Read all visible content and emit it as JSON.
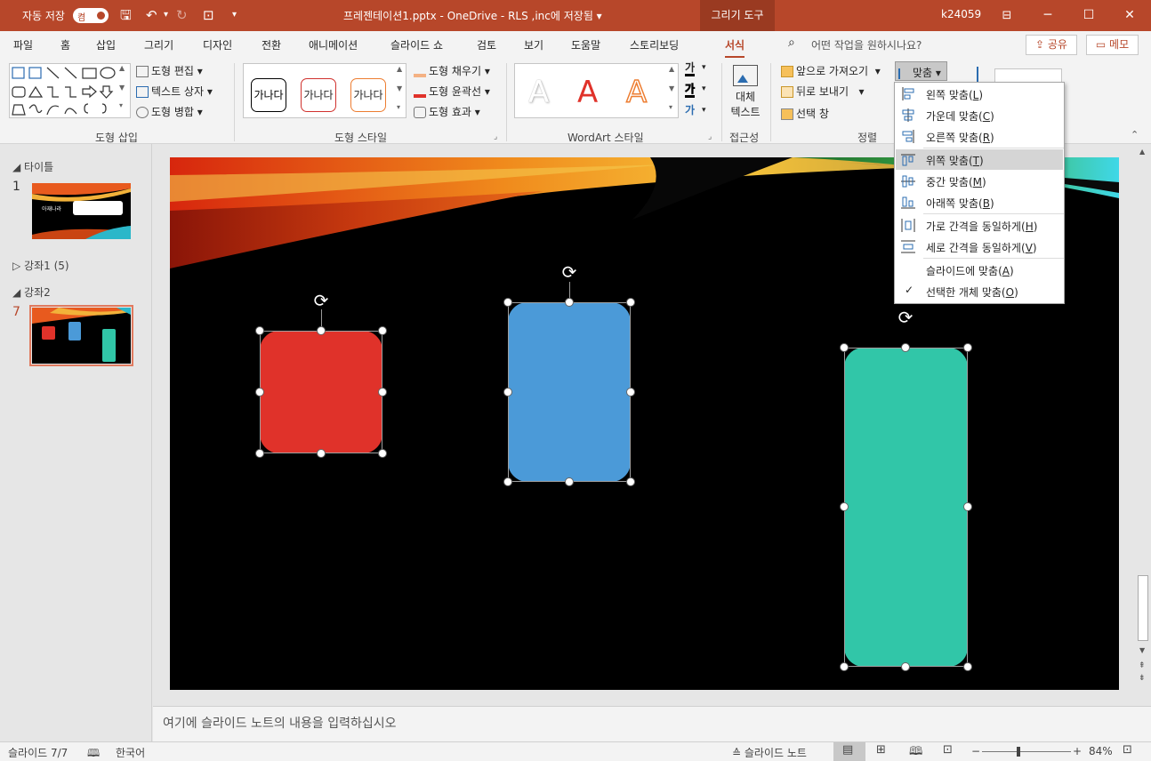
{
  "titlebar": {
    "autosave_label": "자동 저장",
    "autosave_state": "켬",
    "document_title": "프레젠테이션1.pptx - OneDrive - RLS ,inc에 저장됨 ▾",
    "context_tab": "그리기 도구",
    "user": "k24059",
    "color": "#b7472a"
  },
  "tabs": [
    "파일",
    "홈",
    "삽입",
    "그리기",
    "디자인",
    "전환",
    "애니메이션",
    "슬라이드 쇼",
    "검토",
    "보기",
    "도움말",
    "스토리보딩",
    "서식"
  ],
  "search_placeholder": "어떤 작업을 원하시나요?",
  "share_label": "공유",
  "memo_label": "메모",
  "ribbon": {
    "insert_shapes": {
      "edit_shape": "도형 편집",
      "text_box": "텍스트 상자",
      "merge_shapes": "도형 병합",
      "label": "도형 삽입"
    },
    "shape_styles": {
      "style_text": "가나다",
      "fill": "도형 채우기",
      "outline": "도형 윤곽선",
      "effects": "도형 효과",
      "label": "도형 스타일"
    },
    "wordart": {
      "sample": "A",
      "text_color_icon": "가",
      "label": "WordArt 스타일"
    },
    "accessibility": {
      "alt_text_line1": "대체",
      "alt_text_line2": "텍스트",
      "label": "접근성"
    },
    "arrange": {
      "bring_forward": "앞으로 가져오기",
      "send_backward": "뒤로 보내기",
      "selection_pane": "선택 창",
      "align": "맞춤",
      "label": "정렬"
    }
  },
  "align_menu": {
    "items": [
      {
        "label": "왼쪽 맞춤",
        "key": "L"
      },
      {
        "label": "가운데 맞춤",
        "key": "C"
      },
      {
        "label": "오른쪽 맞춤",
        "key": "R"
      },
      {
        "label": "위쪽 맞춤",
        "key": "T",
        "highlighted": true
      },
      {
        "label": "중간 맞춤",
        "key": "M"
      },
      {
        "label": "아래쪽 맞춤",
        "key": "B"
      },
      {
        "label": "가로 간격을 동일하게",
        "key": "H"
      },
      {
        "label": "세로 간격을 동일하게",
        "key": "V"
      },
      {
        "label": "슬라이드에 맞춤",
        "key": "A"
      },
      {
        "label": "선택한 개체 맞춤",
        "key": "O",
        "checked": true
      }
    ]
  },
  "slides_panel": {
    "sections": [
      {
        "name": "타이틀"
      },
      {
        "name": "강좌1 (5)"
      },
      {
        "name": "강좌2"
      }
    ],
    "slide_numbers": [
      "1",
      "7"
    ],
    "thumb1_text": "아재나라"
  },
  "shapes": {
    "red": "#e0322a",
    "blue": "#4b9ad8",
    "green": "#31c6a8"
  },
  "notes_placeholder": "여기에 슬라이드 노트의 내용을 입력하십시오",
  "status": {
    "slide_indicator": "슬라이드 7/7",
    "language": "한국어",
    "notes_toggle": "슬라이드 노트",
    "zoom": "84%"
  }
}
